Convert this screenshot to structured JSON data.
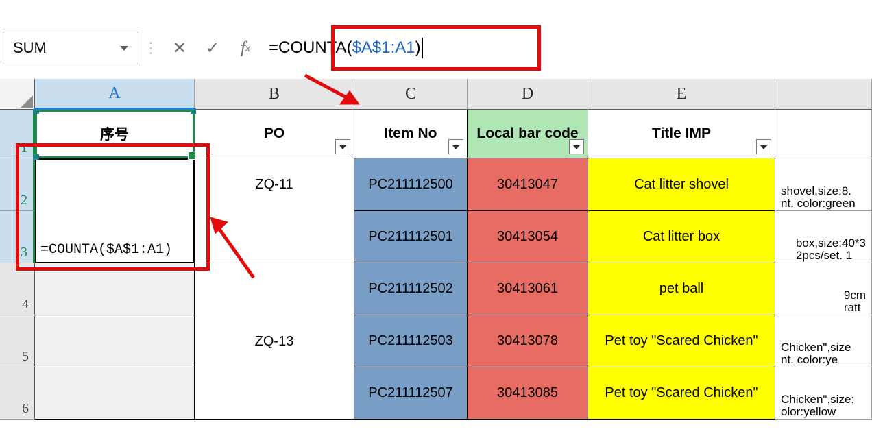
{
  "formula_bar": {
    "name_box": "SUM",
    "formula_prefix_plain": "=COUNTA(",
    "formula_ref": "$A$1:A1",
    "formula_suffix_plain": ")"
  },
  "column_headers": [
    "A",
    "B",
    "C",
    "D",
    "E"
  ],
  "row_headers": [
    "1",
    "2",
    "3",
    "4",
    "5",
    "6"
  ],
  "field_headers": {
    "A": "序号",
    "B": "PO",
    "C": "Item No",
    "D": "Local bar code",
    "E": "Title IMP"
  },
  "cell_edit_formula": "=COUNTA($A$1:A1)",
  "data_rows": [
    {
      "B": "ZQ-11",
      "C": "PC211112500",
      "D": "30413047",
      "E": "Cat litter shovel",
      "F": "shovel,size:8.\nnt. color:green"
    },
    {
      "B": "",
      "C": "PC211112501",
      "D": "30413054",
      "E": "Cat litter box",
      "F": "box,size:40*3\n2pcs/set. 1"
    },
    {
      "B": "ZQ-13",
      "C": "PC211112502",
      "D": "30413061",
      "E": "pet ball",
      "F": "9cm\nratt"
    },
    {
      "B": "",
      "C": "PC211112503",
      "D": "30413078",
      "E": "Pet toy \"Scared Chicken\"",
      "F": "Chicken\",size\nnt. color:ye"
    },
    {
      "B": "",
      "C": "PC211112507",
      "D": "30413085",
      "E": "Pet toy \"Scared Chicken\"",
      "F": "Chicken\",size:\nolor:yellow"
    }
  ]
}
